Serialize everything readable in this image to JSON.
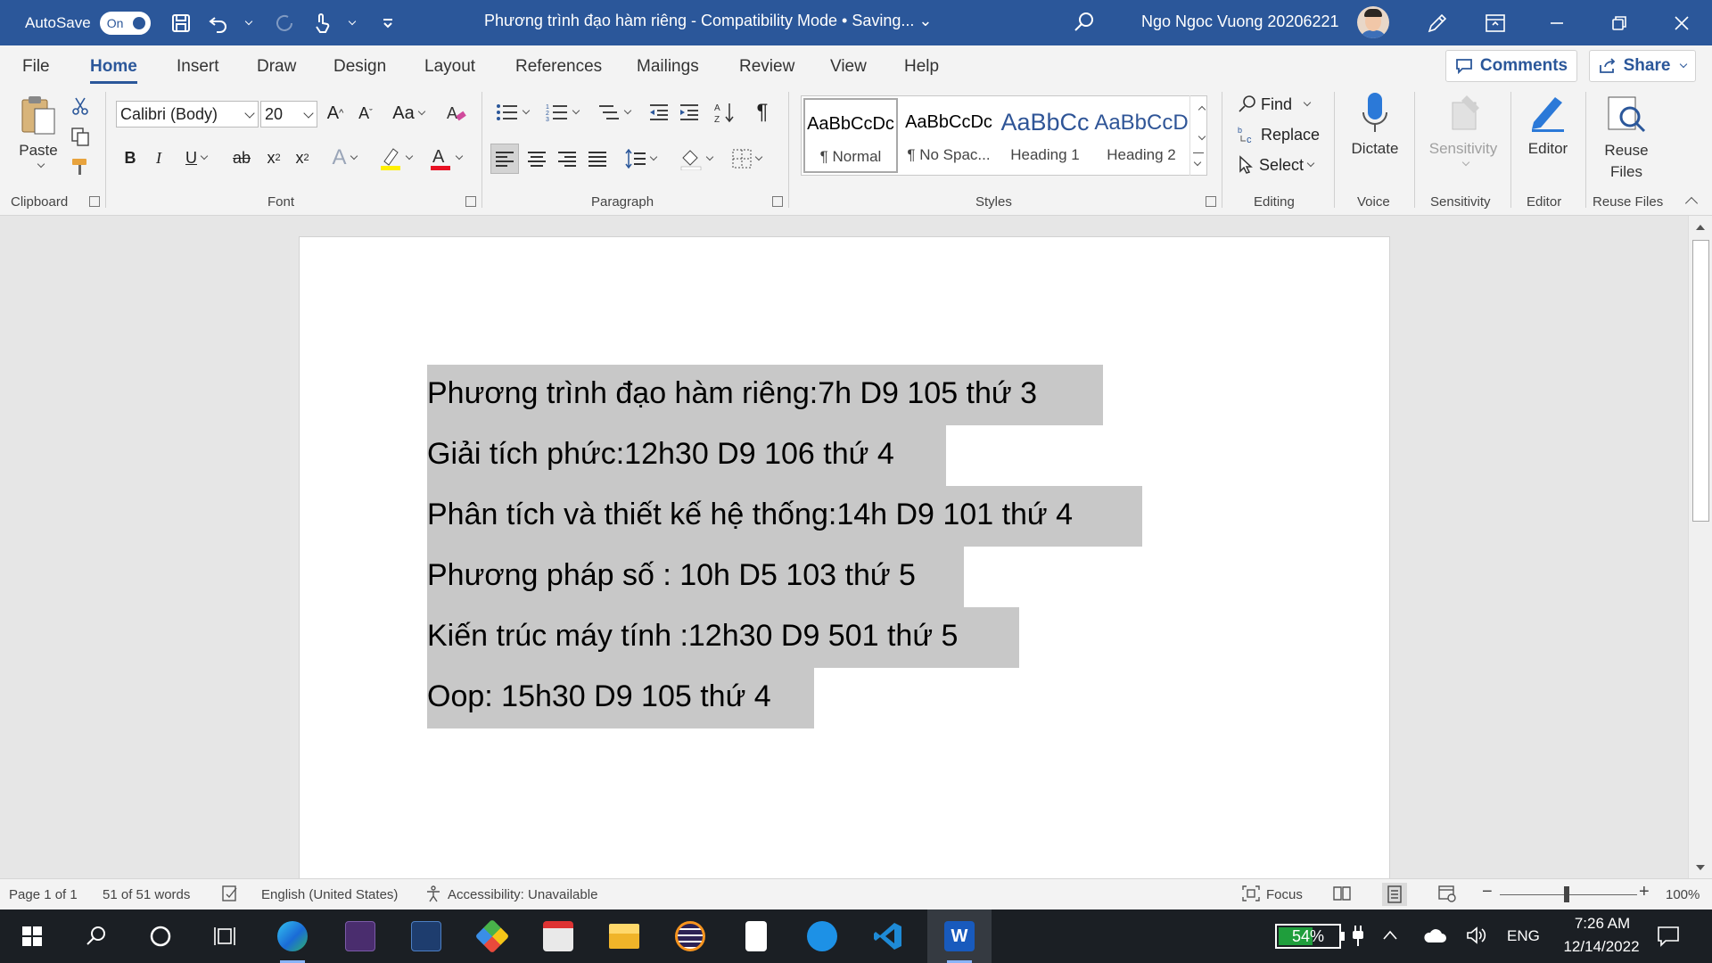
{
  "titlebar": {
    "autosave_label": "AutoSave",
    "autosave_state": "On",
    "document_title": "Phương trình đạo hàm riêng  -  Compatibility Mode • Saving... ⌄",
    "user_name": "Ngo Ngoc Vuong 20206221"
  },
  "tabs": [
    "File",
    "Home",
    "Insert",
    "Draw",
    "Design",
    "Layout",
    "References",
    "Mailings",
    "Review",
    "View",
    "Help"
  ],
  "comments_label": "Comments",
  "share_label": "Share",
  "ribbon": {
    "clipboard": {
      "paste": "Paste",
      "label": "Clipboard"
    },
    "font": {
      "name": "Calibri (Body)",
      "size": "20",
      "label": "Font"
    },
    "paragraph": {
      "label": "Paragraph"
    },
    "styles": {
      "label": "Styles",
      "items": [
        {
          "preview": "AaBbCcDc",
          "name": "¶ Normal"
        },
        {
          "preview": "AaBbCcDc",
          "name": "¶ No Spac..."
        },
        {
          "preview": "AaBbCc",
          "name": "Heading 1"
        },
        {
          "preview": "AaBbCcD",
          "name": "Heading 2"
        }
      ]
    },
    "editing": {
      "find": "Find",
      "replace": "Replace",
      "select": "Select",
      "label": "Editing"
    },
    "voice": {
      "dictate": "Dictate",
      "label": "Voice"
    },
    "sensitivity": {
      "button": "Sensitivity",
      "label": "Sensitivity"
    },
    "editor": {
      "button": "Editor",
      "label": "Editor"
    },
    "reuse": {
      "button_line1": "Reuse",
      "button_line2": "Files",
      "label": "Reuse Files"
    }
  },
  "document": {
    "lines": [
      "Phương trình đạo hàm riêng:7h D9 105 thứ 3",
      "Giải tích phức:12h30 D9 106 thứ 4",
      "Phân tích và thiết kế hệ thống:14h D9 101 thứ 4",
      "Phương pháp số : 10h D5 103 thứ 5",
      "Kiến trúc máy tính :12h30 D9 501 thứ 5",
      "Oop: 15h30 D9 105 thứ 4"
    ]
  },
  "statusbar": {
    "page": "Page 1 of 1",
    "words": "51 of 51 words",
    "language": "English (United States)",
    "accessibility": "Accessibility: Unavailable",
    "focus": "Focus",
    "zoom": "100%"
  },
  "taskbar": {
    "battery": "54%",
    "language": "ENG",
    "time": "7:26 AM",
    "date": "12/14/2022"
  },
  "colors": {
    "title_bar": "#2b579a",
    "selection": "#c8c8c8",
    "taskbar": "#1b1f24",
    "battery_fill": "#1f9e3c"
  }
}
